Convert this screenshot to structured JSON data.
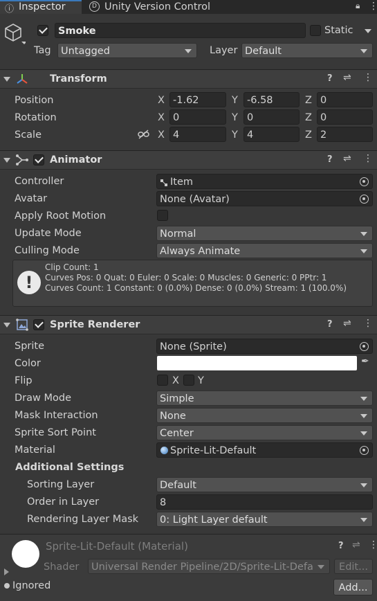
{
  "tabs": {
    "inspector": "Inspector",
    "version_control": "Unity Version Control"
  },
  "object": {
    "name": "Smoke",
    "static_label": "Static",
    "tag_label": "Tag",
    "tag_value": "Untagged",
    "layer_label": "Layer",
    "layer_value": "Default"
  },
  "transform": {
    "title": "Transform",
    "position_label": "Position",
    "rotation_label": "Rotation",
    "scale_label": "Scale",
    "axis_x": "X",
    "axis_y": "Y",
    "axis_z": "Z",
    "position": {
      "x": "-1.62",
      "y": "-6.58",
      "z": "0"
    },
    "rotation": {
      "x": "0",
      "y": "0",
      "z": "0"
    },
    "scale": {
      "x": "4",
      "y": "4",
      "z": "2"
    }
  },
  "animator": {
    "title": "Animator",
    "controller_label": "Controller",
    "controller_value": "Item",
    "avatar_label": "Avatar",
    "avatar_value": "None (Avatar)",
    "apply_root_motion_label": "Apply Root Motion",
    "update_mode_label": "Update Mode",
    "update_mode_value": "Normal",
    "culling_mode_label": "Culling Mode",
    "culling_mode_value": "Always Animate",
    "info_line1": "Clip Count: 1",
    "info_line2": "Curves Pos: 0 Quat: 0 Euler: 0 Scale: 0 Muscles: 0 Generic: 0 PPtr: 1",
    "info_line3": "Curves Count: 1 Constant: 0 (0.0%) Dense: 0 (0.0%) Stream: 1 (100.0%)"
  },
  "sprite_renderer": {
    "title": "Sprite Renderer",
    "sprite_label": "Sprite",
    "sprite_value": "None (Sprite)",
    "color_label": "Color",
    "color_value": "#ffffff",
    "flip_label": "Flip",
    "flip_x": "X",
    "flip_y": "Y",
    "draw_mode_label": "Draw Mode",
    "draw_mode_value": "Simple",
    "mask_interaction_label": "Mask Interaction",
    "mask_interaction_value": "None",
    "sort_point_label": "Sprite Sort Point",
    "sort_point_value": "Center",
    "material_label": "Material",
    "material_value": "Sprite-Lit-Default",
    "additional_settings_label": "Additional Settings",
    "sorting_layer_label": "Sorting Layer",
    "sorting_layer_value": "Default",
    "order_in_layer_label": "Order in Layer",
    "order_in_layer_value": "8",
    "rendering_layer_mask_label": "Rendering Layer Mask",
    "rendering_layer_mask_value": "0: Light Layer default"
  },
  "material_section": {
    "title": "Sprite-Lit-Default (Material)",
    "shader_label": "Shader",
    "shader_value": "Universal Render Pipeline/2D/Sprite-Lit-Defa",
    "edit_button": "Edit...",
    "ignored_label": "Ignored",
    "add_button": "Add..."
  },
  "colors": {
    "accent_blue": "#3a79bb",
    "panel": "#383838",
    "header": "#3e3e3e"
  }
}
